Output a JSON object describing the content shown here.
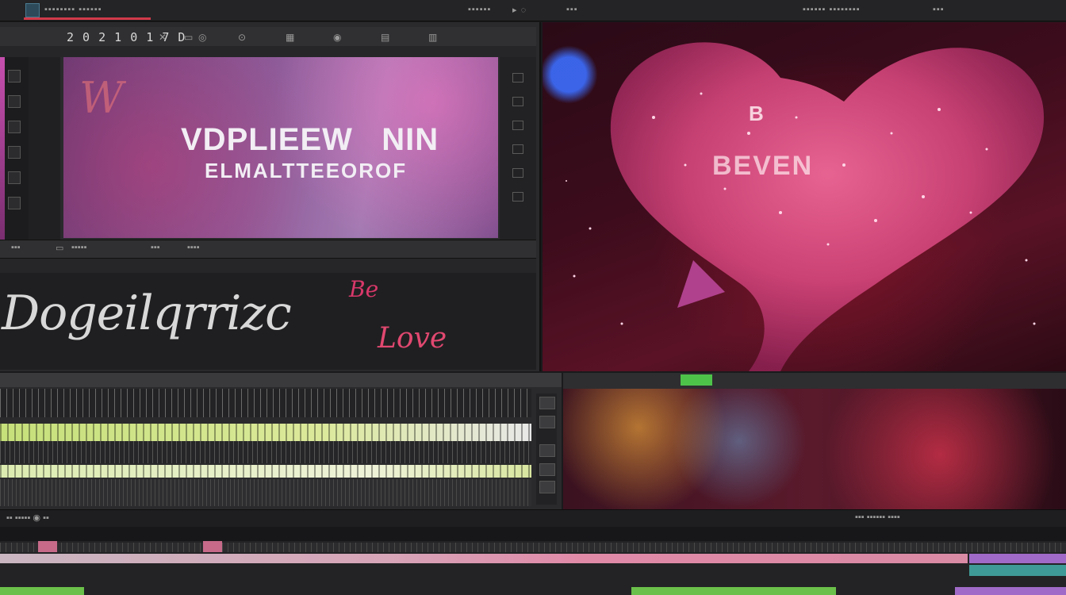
{
  "menubar": {
    "left_label": "▪▪▪▪▪▪▪▪ ▪▪▪▪▪▪",
    "center_label": "▪▪▪▪▪▪",
    "center_icons": "▸  ◌",
    "center_label2": "▪▪▪",
    "right_label": "▪▪▪▪▪▪ ▪▪▪▪▪▪▪▪",
    "right_label2": "▪▪▪"
  },
  "editor": {
    "timecode": "2 0 2 1 0 1 7 D",
    "close_glyph": "✕",
    "toolbar_glyphs": [
      "▭",
      "◎",
      "⊙",
      "▦",
      "◉",
      "▤",
      "▥"
    ],
    "viewer": {
      "line1": "VDPLIEEW",
      "line1b": "NIN",
      "line2": "ELMALTTEEOROF",
      "scrawl": "W"
    },
    "mid_bar_glyphs": [
      "▪▪▪",
      "▭",
      "▪▪▪▪▪",
      "▪▪▪",
      "▪▪▪▪"
    ],
    "titles": {
      "script": "Dogeilqrrizc",
      "be": "Be",
      "love": "Love"
    }
  },
  "preview": {
    "word1": "B",
    "word2": "BEVEN"
  },
  "status_bar": {
    "left_glyphs": "▪▪ ▪▪▪▪▪  ◉ ▪▪",
    "right_glyphs": "▪▪▪ ▪▪▪▪▪▪ ▪▪▪▪"
  },
  "colors": {
    "accent_red": "#d13a4a",
    "track_green": "#c6e07a",
    "tag_green": "#4ec34a",
    "love_pink": "#e04870",
    "clip_purple": "#a06ac8",
    "clip_teal": "#3e9a96"
  }
}
